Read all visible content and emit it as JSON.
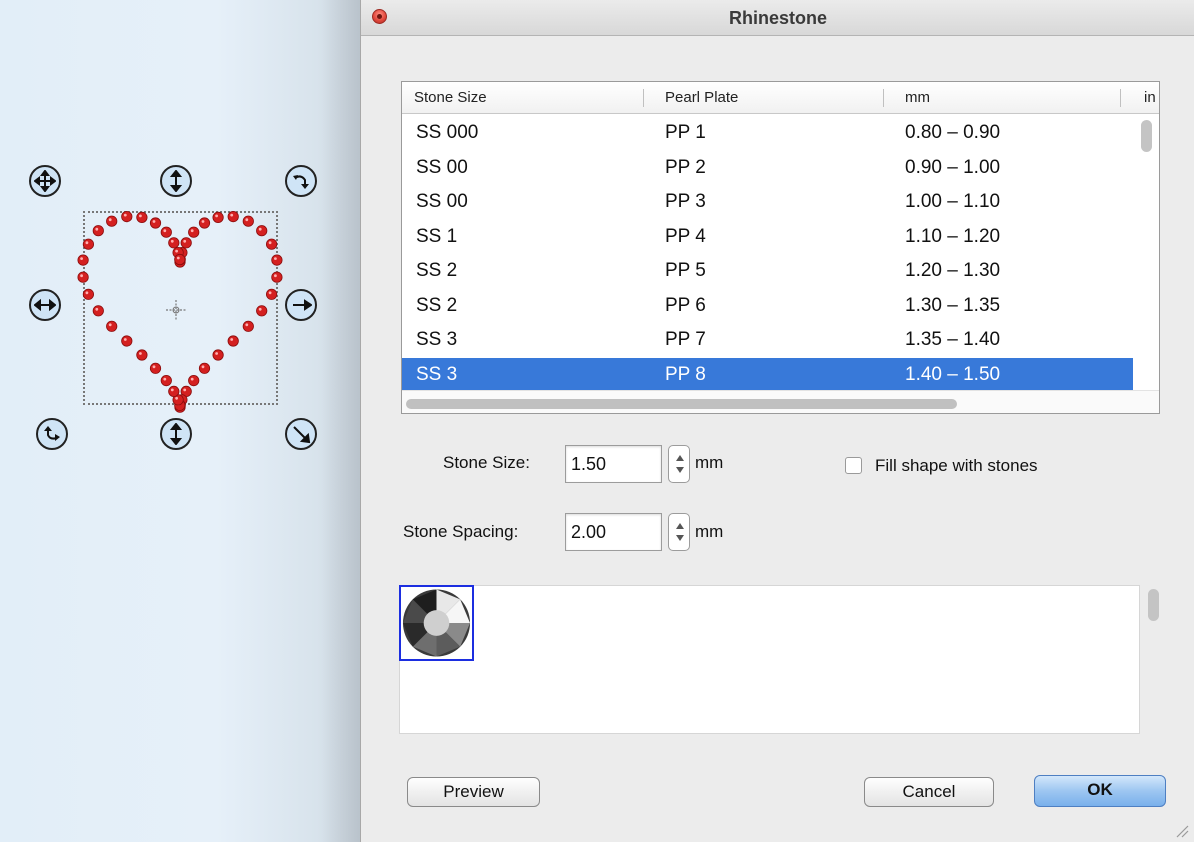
{
  "window": {
    "title": "Rhinestone"
  },
  "table": {
    "columns": [
      "Stone Size",
      "Pearl Plate",
      "mm",
      "in"
    ],
    "rows": [
      [
        "SS 000",
        "PP 1",
        "0.80 – 0.90"
      ],
      [
        "SS 00",
        "PP 2",
        "0.90 – 1.00"
      ],
      [
        "SS 00",
        "PP 3",
        "1.00 – 1.10"
      ],
      [
        "SS 1",
        "PP 4",
        "1.10 – 1.20"
      ],
      [
        "SS 2",
        "PP 5",
        "1.20 – 1.30"
      ],
      [
        "SS 2",
        "PP 6",
        "1.30 – 1.35"
      ],
      [
        "SS 3",
        "PP 7",
        "1.35 – 1.40"
      ],
      [
        "SS 3",
        "PP 8",
        "1.40 – 1.50"
      ]
    ],
    "selected_row": 7
  },
  "form": {
    "stone_size_label": "Stone Size:",
    "stone_size_value": "1.50",
    "stone_size_unit": "mm",
    "stone_spacing_label": "Stone Spacing:",
    "stone_spacing_value": "2.00",
    "stone_spacing_unit": "mm",
    "fill_shape_label": "Fill shape with stones",
    "fill_shape_checked": false
  },
  "buttons": {
    "preview": "Preview",
    "cancel": "Cancel",
    "ok": "OK"
  },
  "colors": {
    "selection": "#3879d9",
    "stone_red": "#d42020",
    "tile_border": "#1c2ee0"
  },
  "icons": {
    "handles": [
      "move-icon",
      "stretch-vertical-icon",
      "rotate-icon",
      "stretch-horizontal-icon",
      "scale-icon"
    ]
  }
}
